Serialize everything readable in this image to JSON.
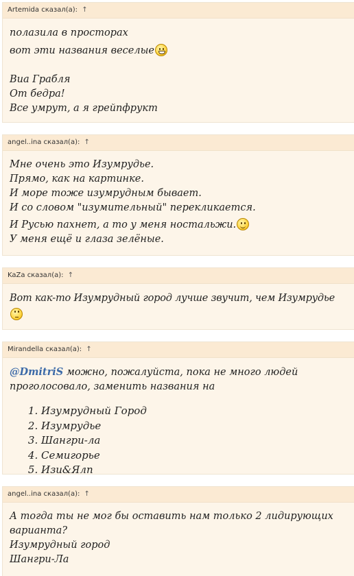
{
  "quotes": [
    {
      "author": "Artemida",
      "said": "сказал(а):",
      "arrow": "↑",
      "lines": [
        "полазила в просторах",
        "вот эти названия веселые",
        "",
        "Виа Грабля",
        "От бедра!",
        "Все умрут, а я грейпфрукт"
      ]
    },
    {
      "author": "angel..ina",
      "said": "сказал(а):",
      "arrow": "↑",
      "lines": [
        "Мне очень это Изумрудье.",
        "Прямо, как на картинке.",
        "И море тоже изумрудным бывает.",
        "И со словом \"изумительный\" перекликается.",
        "И Русью пахнет, а то у меня ностальжи.",
        "У меня ещё и глаза зелёные."
      ]
    },
    {
      "author": "KaZa",
      "said": "сказал(а):",
      "arrow": "↑",
      "lines": [
        "Вот как-то Изумрудный город лучше звучит, чем Изумрудье"
      ]
    },
    {
      "author": "Mirandella",
      "said": "сказал(а):",
      "arrow": "↑",
      "mention": "@DmitriS",
      "lines": [
        "можно, пожалуйста, пока не много людей проголосовало, заменить названия на"
      ],
      "list": [
        "Изумрудный Город",
        "Изумрудье",
        "Шангри-ла",
        "Семигорье",
        "Изи&Ялп"
      ]
    },
    {
      "author": "angel..ina",
      "said": "сказал(а):",
      "arrow": "↑",
      "lines": [
        "А тогда ты не мог бы оставить нам только 2 лидирующих варианта?",
        "Изумрудный город",
        "Шангри-Ла"
      ]
    }
  ],
  "icons": {
    "grin": "grinning-smiley",
    "smile": "smiley",
    "roll": "rolling-eyes-smiley"
  }
}
